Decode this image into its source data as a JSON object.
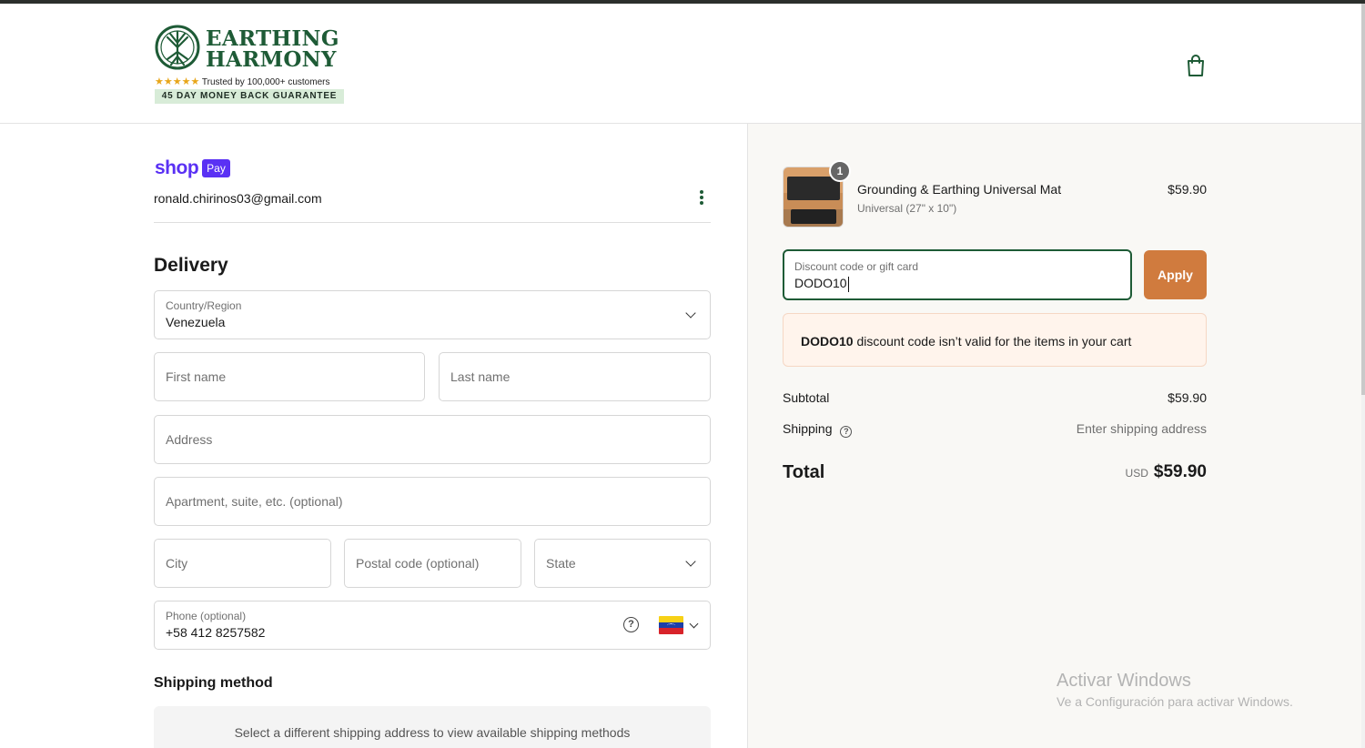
{
  "brand": {
    "line1": "EARTHING",
    "line2": "HARMONY",
    "stars": "★★★★★",
    "trust": "Trusted by 100,000+ customers",
    "guarantee": "45 DAY MONEY BACK GUARANTEE",
    "color": "#1e5b36"
  },
  "shoppay": {
    "shop": "shop",
    "pay": "Pay",
    "email": "ronald.chirinos03@gmail.com",
    "color": "#5a31f4"
  },
  "delivery": {
    "heading": "Delivery",
    "country_label": "Country/Region",
    "country_value": "Venezuela",
    "first_name_placeholder": "First name",
    "last_name_placeholder": "Last name",
    "address_placeholder": "Address",
    "apartment_placeholder": "Apartment, suite, etc. (optional)",
    "city_placeholder": "City",
    "postal_placeholder": "Postal code (optional)",
    "state_placeholder": "State",
    "phone_label": "Phone (optional)",
    "phone_value": "+58 412 8257582",
    "help_glyph": "?"
  },
  "shipping_method": {
    "heading": "Shipping method",
    "notice": "Select a different shipping address to view available shipping methods"
  },
  "summary": {
    "product": {
      "name": "Grounding & Earthing Universal Mat",
      "variant": "Universal (27\" x 10\")",
      "price": "$59.90",
      "quantity": "1"
    },
    "discount": {
      "label": "Discount code or gift card",
      "value": "DODO10",
      "apply_label": "Apply",
      "apply_color": "#d07b3e"
    },
    "error": {
      "code": "DODO10",
      "message": " discount code isn’t valid for the items in your cart"
    },
    "subtotal_label": "Subtotal",
    "subtotal_value": "$59.90",
    "shipping_label": "Shipping",
    "shipping_value": "Enter shipping address",
    "total_label": "Total",
    "total_currency": "USD",
    "total_value": "$59.90"
  },
  "windows_watermark": {
    "title": "Activar Windows",
    "subtitle": "Ve a Configuración para activar Windows."
  }
}
